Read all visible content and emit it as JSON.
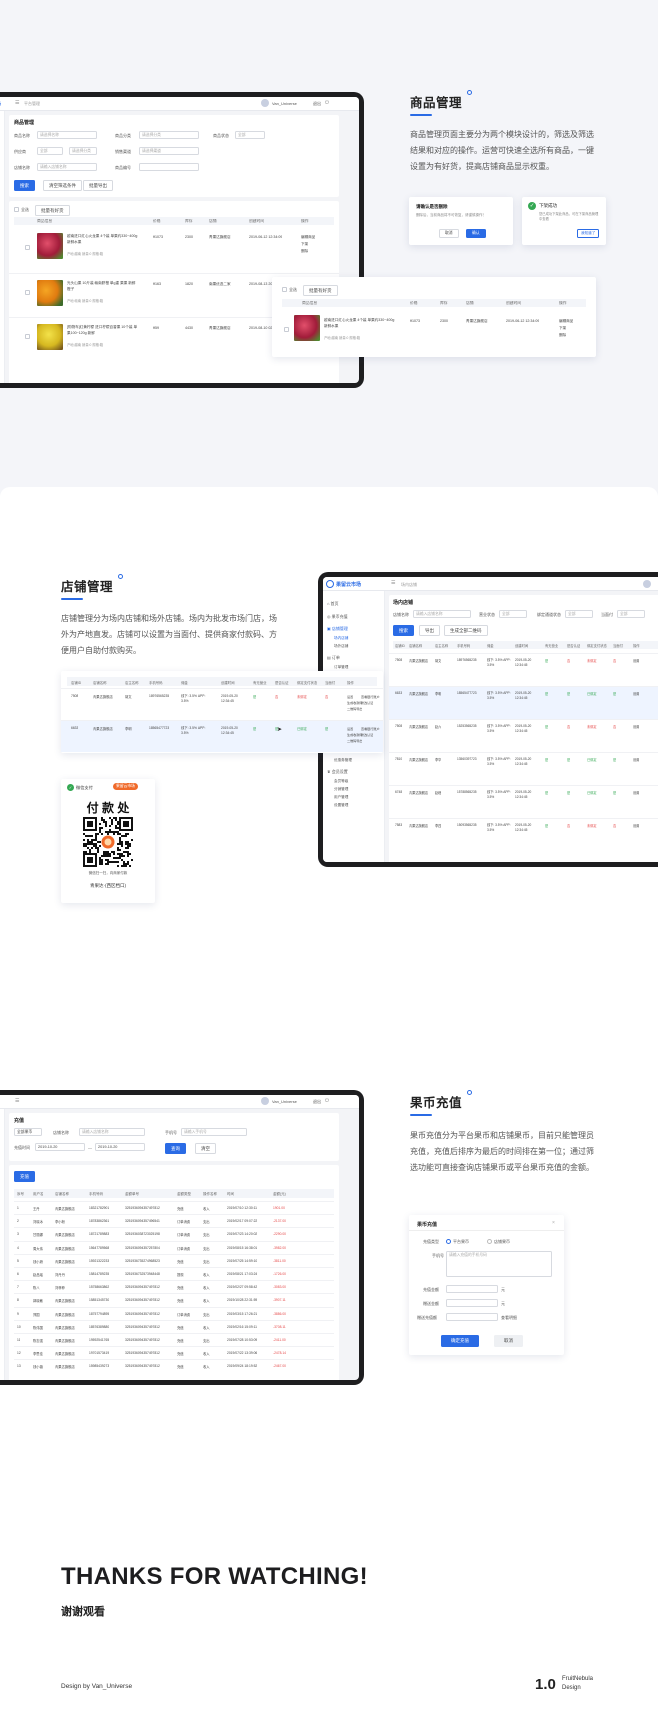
{
  "section1": {
    "title": "商品管理",
    "desc": "商品管理页面主要分为两个模块设计的，筛选及筛选结果和对应的操作。运营可快速全选所有商品，一键设置为有好货，提高店铺商品显示权重。",
    "screen": {
      "topbar_left": "市场",
      "topbar_search": "平台管理",
      "user": "Van_Universe",
      "logout": "退出",
      "page_title": "商品管理",
      "filters": [
        {
          "label": "商品名称",
          "value": "请选择名称"
        },
        {
          "label": "商品分类",
          "value": "请选择分类"
        },
        {
          "label": "商品状态",
          "value": "全部"
        },
        {
          "label": "供应商",
          "value": "全部"
        },
        {
          "label": "",
          "value": "请选择分类"
        },
        {
          "label": "销售渠道",
          "value": "请选择渠道"
        },
        {
          "label": "店铺名称",
          "value": "请输入店铺名称"
        },
        {
          "label": "商品编号",
          "value": ""
        }
      ],
      "buttons": [
        "搜索",
        "清空筛选条件",
        "批量导出"
      ],
      "select_all": "全选",
      "batch_btn": "批量有好货",
      "columns": [
        "商品信息",
        "价格",
        "库存",
        "店铺",
        "创建时间",
        "操作"
      ],
      "rows": [
        {
          "name": "越南进口红心火龙果 4个装 单果约330~400g 新鲜水果",
          "meta": "产地:越南  销量:0  规格:箱",
          "price": "¥1073",
          "stock": "2300",
          "shop": "青果达旗舰店",
          "time": "2019-06-12 12:34:09",
          "ops": [
            "编辑商品",
            "下架",
            "删除"
          ]
        },
        {
          "name": "光头山果 10斤装 赣南脐橙 单g重 果果 新鲜橙子",
          "meta": "产地:赣南  销量:0  规格:箱",
          "price": "¥163",
          "stock": "1820",
          "shop": "南果优选二家",
          "time": "2019-08-13 20:15:11",
          "ops": [
            "编辑商品",
            "下架",
            "删除"
          ]
        },
        {
          "name": "[购物车]红黄柠檬 进口柠檬百香果 10个装 单果100~120g 新鲜",
          "meta": "产地:越南  销量:0  规格:箱",
          "price": "¥59",
          "stock": "4430",
          "shop": "青果达旗舰店",
          "time": "2019-08-10 02:18:47",
          "ops": [
            "编辑商品",
            "下架",
            "删除"
          ]
        }
      ]
    },
    "confirm_card": {
      "title": "请确认是否删除",
      "text": "删除后，当前商品将不可恢复，请谨慎操作！",
      "cancel": "取消",
      "ok": "确认"
    },
    "success_card": {
      "title": "下架成功",
      "text": "您已成功下架此商品，可在下架商品管理中查看",
      "btn": "我知道了"
    },
    "popout": {
      "select_all": "全选",
      "batch_btn": "批量有好货",
      "columns": [
        "商品信息",
        "价格",
        "库存",
        "店铺",
        "创建时间",
        "操作"
      ],
      "row": {
        "name": "越南进口红心火龙果 4个装 单果约330~400g 新鲜水果",
        "meta": "产地:越南  销量:0  规格:箱",
        "price": "¥1073",
        "stock": "2300",
        "shop": "青果达旗舰店",
        "time": "2019-06-12 12:34:09",
        "ops": [
          "编辑商品",
          "下架",
          "删除"
        ]
      }
    }
  },
  "section2": {
    "title": "店铺管理",
    "desc": "店铺管理分为场内店铺和场外店铺。场内为批发市场门店，场外为产地直发。店铺可以设置为当面付、提供商家付款码、方便用户自助付款购买。",
    "screen": {
      "brand": "果留云市场",
      "topbar_search": "场内店铺",
      "page_title": "场内店铺",
      "filters": [
        {
          "label": "店铺名称",
          "value": "请输入店铺名称"
        },
        {
          "label": "营业状态",
          "value": "全部"
        },
        {
          "label": "绑定通道状态",
          "value": "全部"
        },
        {
          "label": "当面付",
          "value": "全部"
        }
      ],
      "buttons": [
        "搜索",
        "导出",
        "生成全部二维码"
      ],
      "sidebar": [
        "首页",
        "果币充值",
        "店铺管理",
        "场内店铺",
        "场外店铺",
        "订单",
        "订单管理",
        "售后管理",
        "商品管理",
        "结算管理",
        "用户管理",
        "运营管理",
        "合作伙伴",
        "运营配置",
        "广告配置",
        "优惠券",
        "优惠券管理",
        "会员设置",
        "会员等级",
        "分销管理",
        "用户管理",
        "设置管理"
      ],
      "columns": [
        "店铺ID",
        "店铺名称",
        "店主名称",
        "手机号码",
        "佣金",
        "创建时间",
        "有无营业",
        "是否认证",
        "绑定支付状态",
        "当面付",
        "操作"
      ],
      "rows": [
        {
          "id": "7508",
          "name": "青果达旗舰店",
          "owner": "胡文",
          "phone": "18976565235",
          "fee": "线下: 3.5%  APP: 3.5%",
          "time": "2019-05-20 12:34:45",
          "open": "是",
          "auth": "否",
          "pay": "未绑定",
          "face": "否"
        },
        {
          "id": "6633",
          "name": "青果达旗舰店",
          "owner": "李明",
          "phone": "18565477723",
          "fee": "线下: 3.5%  APP: 3.5%",
          "time": "2019-05-20 12:34:45",
          "open": "是",
          "auth": "是",
          "pay": "已绑定",
          "face": "是"
        },
        {
          "id": "7508",
          "name": "青果达旗舰店",
          "owner": "赵六",
          "phone": "15253565235",
          "fee": "线下: 3.5%  APP: 3.5%",
          "time": "2019-05-20 12:34:45",
          "open": "是",
          "auth": "否",
          "pay": "未绑定",
          "face": "否"
        },
        {
          "id": "7810",
          "name": "青果达旗舰店",
          "owner": "李华",
          "phone": "13560397723",
          "fee": "线下: 3.5%  APP: 3.5%",
          "time": "2019-05-20 12:34:45",
          "open": "是",
          "auth": "是",
          "pay": "已绑定",
          "face": "是"
        },
        {
          "id": "6748",
          "name": "青果达旗舰店",
          "owner": "赵峰",
          "phone": "15788565235",
          "fee": "线下: 3.5%  APP: 3.5%",
          "time": "2019-05-20 12:34:45",
          "open": "是",
          "auth": "是",
          "pay": "已绑定",
          "face": "是"
        },
        {
          "id": "7583",
          "name": "青果达旗舰店",
          "owner": "李四",
          "phone": "15093565235",
          "fee": "线下: 3.5%  APP: 3.5%",
          "time": "2019-05-20 12:34:45",
          "open": "是",
          "auth": "否",
          "pay": "未绑定",
          "face": "否"
        }
      ],
      "ops": [
        "设置",
        "查看银行账户",
        "生成收款码",
        "修改认证",
        "二维码导出",
        "立即认证"
      ]
    },
    "table_popout": {
      "columns": [
        "店铺ID",
        "店铺名称",
        "店主名称",
        "手机号码",
        "佣金",
        "创建时间",
        "有无营业",
        "是否认证",
        "绑定支付状态",
        "当面付",
        "操作"
      ],
      "rows": [
        {
          "id": "7508",
          "name": "青果达旗舰店",
          "owner": "胡文",
          "phone": "18976565235",
          "fee": "线下: 3.5%  APP: 3.5%",
          "time": "2019-05-20 12:34:45",
          "open": "是",
          "auth": "否",
          "pay": "未绑定",
          "face": "否",
          "ops": [
            "设置",
            "查看银行账户",
            "生成收款码",
            "修改认证",
            "二维码导出"
          ]
        },
        {
          "id": "6633",
          "name": "青果达旗舰店",
          "owner": "李明",
          "phone": "18565477723",
          "fee": "线下: 3.5%  APP: 3.5%",
          "time": "2019-05-20 12:34:45",
          "open": "是",
          "auth": "是",
          "pay": "已绑定",
          "face": "是",
          "ops": [
            "设置",
            "查看银行账户",
            "生成收款码",
            "修改认证",
            "二维码导出"
          ]
        }
      ]
    },
    "paycard": {
      "wechat": "微信支付",
      "brand": "果留云市场",
      "title": "付 款 处",
      "hint": "微信扫一扫，向商家付款",
      "shop": "青果达·(西区档口)"
    }
  },
  "section3": {
    "title": "果币充值",
    "desc": "果币充值分为平台果币和店铺果币，目前只能管理员充值，充值后排序为最后的时间排在第一位；通过筛选功能可直接查询店铺果币或平台果币充值的金额。",
    "screen": {
      "user": "Van_Universe",
      "logout": "退出",
      "page_title": "充值",
      "filters": [
        {
          "label": "全部果币",
          "value": ""
        },
        {
          "label": "店铺名称",
          "value": "请输入店铺名称"
        },
        {
          "label": "手机号",
          "value": "请输入手机号"
        },
        {
          "label": "充值时间",
          "value": "2019-10-20"
        },
        {
          "label": "",
          "value": "2019-10-20"
        }
      ],
      "buttons": [
        "查询",
        "清空",
        "充值"
      ],
      "columns": [
        "序号",
        "用户名",
        "店铺名称",
        "手机号码",
        "金额单号",
        "金额类型",
        "操作名称",
        "时间",
        "金额(元)"
      ],
      "rows": [
        [
          "1",
          "王丹",
          "青果达旗舰店",
          "18321782901",
          "3251936094357497812",
          "充值",
          "收入",
          "2019/07/10 12:30:11",
          "1901.00"
        ],
        [
          "2",
          "刘晓冰",
          "李小粉",
          "18783862361",
          "3251936094357496541",
          "订单消费",
          "支出",
          "2019/02/17 09:07:22",
          "-2137.00"
        ],
        [
          "3",
          "甘丽娜",
          "青果达旗舰店",
          "18721789883",
          "3251936038723025198",
          "订单消费",
          "支出",
          "2019/07/23 14:20:02",
          "-2290.00"
        ],
        [
          "4",
          "周大伟",
          "青果达旗舰店",
          "15647789568",
          "3251936094357257804",
          "订单消费",
          "支出",
          "2019/08/15 16:38:01",
          "-3982.00"
        ],
        [
          "5",
          "钱小娇",
          "青果达旗舰店",
          "15921322233",
          "3251936735274968523",
          "充值",
          "支出",
          "2019/07/25 14:59:10",
          "-3811.00"
        ],
        [
          "6",
          "赵品瑶",
          "刘丹丹",
          "15814789235",
          "3251936732573948448",
          "提现",
          "收入",
          "2019/08/21 17:03:24",
          "-1726.00"
        ],
        [
          "7",
          "陈八",
          "刘菲菲",
          "15758663862",
          "3251936094357497812",
          "充值",
          "收入",
          "2019/02/27 09:58:42",
          "-3083.00"
        ],
        [
          "8",
          "郭晓敏",
          "青果达旗舰店",
          "15851345730",
          "3251936094357497812",
          "充值",
          "收入",
          "2019/10/28 22:31:59",
          "-3907.11"
        ],
        [
          "9",
          "郑国",
          "青果达旗舰店",
          "18757794895",
          "3251936094357497812",
          "订单消费",
          "支出",
          "2019/03/15 17:26:21",
          "-3886.00"
        ],
        [
          "10",
          "陈伟国",
          "青果达旗舰店",
          "18576389880",
          "3251936094357497812",
          "充值",
          "收入",
          "2019/02/16 15:09:11",
          "-3708.11"
        ],
        [
          "11",
          "陈志强",
          "青果达旗舰店",
          "19592541765",
          "3251936094357497812",
          "充值",
          "支出",
          "2019/07/28 10:53:09",
          "-2411.00"
        ],
        [
          "12",
          "李思佳",
          "青果达旗舰店",
          "19701573419",
          "3251936094357497812",
          "充值",
          "收入",
          "2019/07/22 13:39:06",
          "-2478.14"
        ],
        [
          "13",
          "钱小薇",
          "青果达旗舰店",
          "15985439273",
          "3251936094357497812",
          "充值",
          "收入",
          "2019/09/24 18:19:52",
          "-2467.00"
        ]
      ]
    },
    "dialog": {
      "title": "果币充值",
      "type_label": "充值类型",
      "type_platform": "平台果币",
      "type_shop": "店铺果币",
      "phone_label": "手机号",
      "phone_placeholder": "请输入充值的手机号码",
      "amount_label": "充值金额",
      "give_label": "赠送金额",
      "bonus_label": "赠送充值额",
      "unit": "元",
      "link": "查看明细",
      "confirm": "确定充值",
      "cancel": "取消"
    }
  },
  "footer": {
    "thanks": "THANKS FOR WATCHING!",
    "thanks_cn": "谢谢观看",
    "credit": "Design by Van_Universe",
    "version": "1.0",
    "brand_line1": "FruitNebula",
    "brand_line2": "Design"
  },
  "colors": {
    "accent": "#2a6be5",
    "dark_device": "#1e1e20",
    "bg": "#f4f5f9"
  }
}
